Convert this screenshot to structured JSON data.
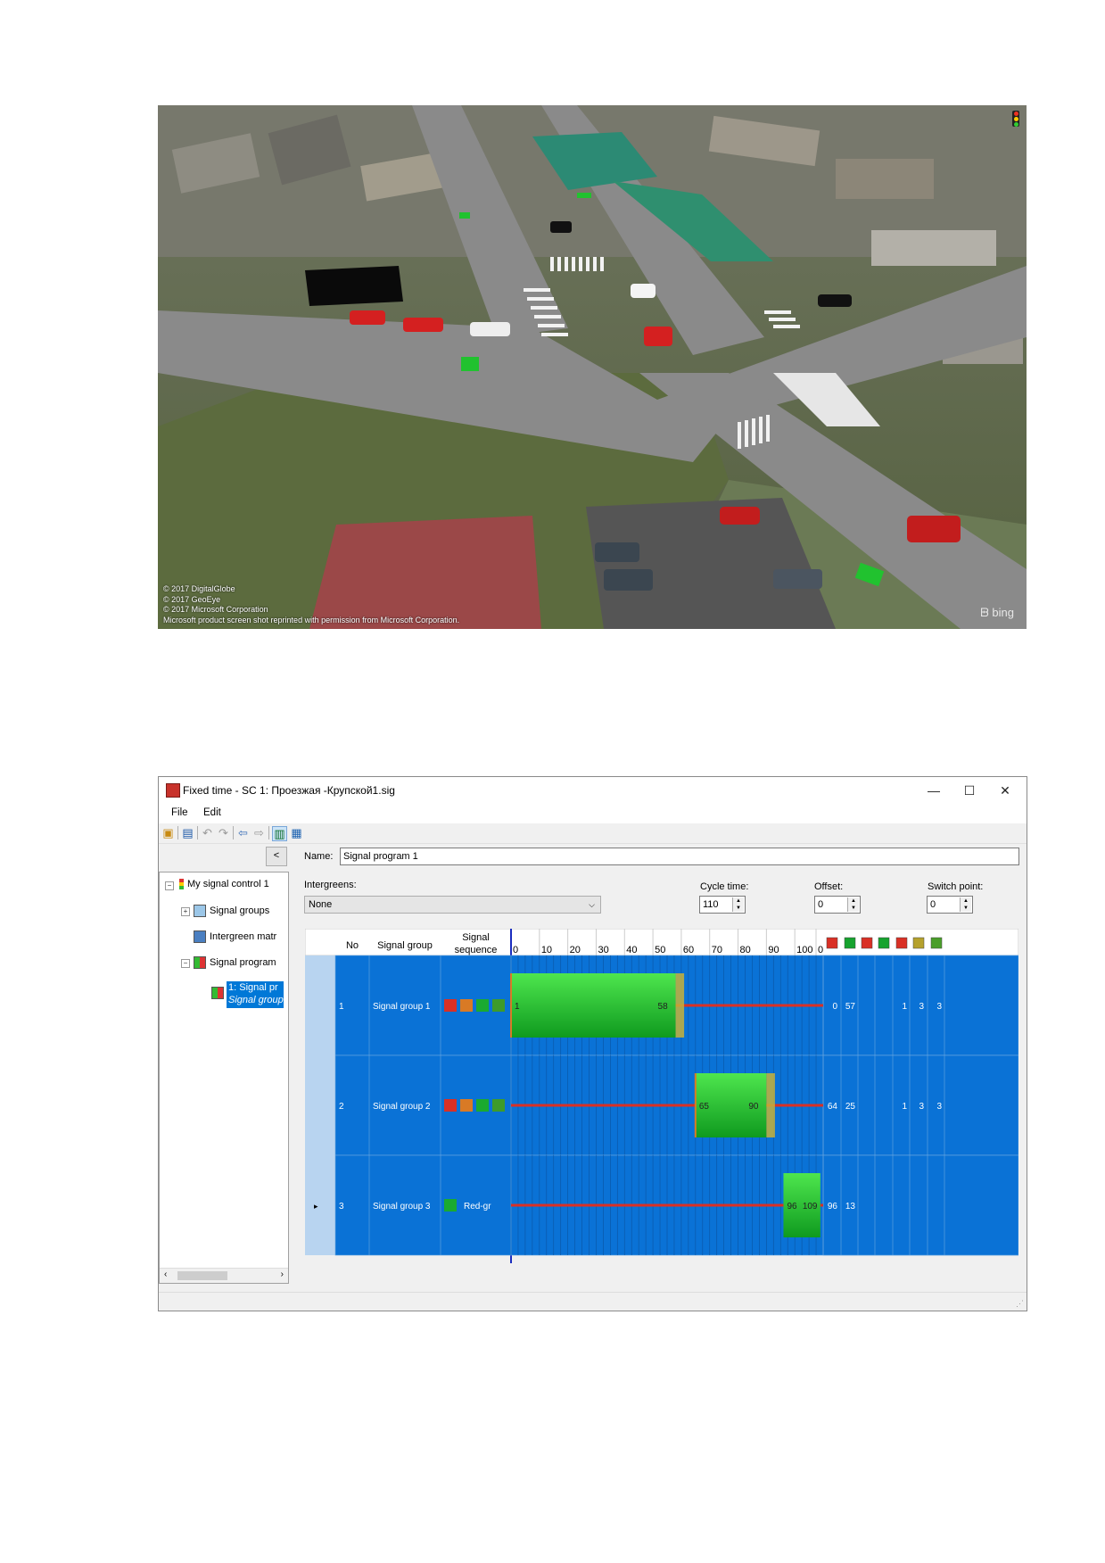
{
  "photo": {
    "credits": [
      "© 2017 DigitalGlobe",
      "© 2017 GeoEye",
      "© 2017 Microsoft Corporation",
      "Microsoft product screen shot reprinted with permission from Microsoft Corporation."
    ],
    "bing_logo": "bing"
  },
  "window": {
    "title": "Fixed time - SC 1: Проезжая -Крупской1.sig",
    "controls": {
      "minimize": "—",
      "maximize": "☐",
      "close": "✕"
    },
    "menu": {
      "file": "File",
      "edit": "Edit"
    }
  },
  "tree": {
    "collapse_label": "<",
    "root": "My signal control 1",
    "items": [
      "Signal groups",
      "Intergreen matr",
      "Signal program"
    ],
    "selected_line1": "1: Signal pr",
    "selected_line2": "Signal group"
  },
  "form": {
    "name_label": "Name:",
    "name_value": "Signal program 1",
    "intergreens_label": "Intergreens:",
    "intergreens_value": "None",
    "cycle_label": "Cycle time:",
    "cycle_value": "110",
    "offset_label": "Offset:",
    "offset_value": "0",
    "switch_label": "Switch point:",
    "switch_value": "0"
  },
  "grid": {
    "headers": {
      "no": "No",
      "group": "Signal group",
      "seq1": "Signal",
      "seq2": "sequence"
    },
    "time_ticks": [
      "0",
      "10",
      "20",
      "30",
      "40",
      "50",
      "60",
      "70",
      "80",
      "90",
      "100",
      "0"
    ],
    "colors": {
      "row_bg": "#0a72d6",
      "green_top": "#4ee64e",
      "green_bottom": "#0f9a1f",
      "red": "#d93025",
      "header_bg": "#ffffff"
    },
    "rows": [
      {
        "no": "1",
        "name": "Signal group 1",
        "seq_text": "",
        "green_start": 0,
        "green_end": 58,
        "start_label": "1",
        "end_label": "58",
        "amber": true,
        "val_red_end": "0",
        "val_green_dur": "57",
        "c1": "1",
        "c2": "3",
        "c3": "3"
      },
      {
        "no": "2",
        "name": "Signal group 2",
        "seq_text": "",
        "green_start": 65,
        "green_end": 90,
        "start_label": "65",
        "end_label": "90",
        "amber": true,
        "val_red_end": "64",
        "val_green_dur": "25",
        "c1": "1",
        "c2": "3",
        "c3": "3"
      },
      {
        "no": "3",
        "name": "Signal group 3",
        "seq_text": "Red-gr",
        "green_start": 96,
        "green_end": 109,
        "start_label": "96",
        "end_label": "109",
        "amber": false,
        "val_red_end": "96",
        "val_green_dur": "13",
        "c1": "",
        "c2": "",
        "c3": ""
      }
    ],
    "cycle": 110
  }
}
